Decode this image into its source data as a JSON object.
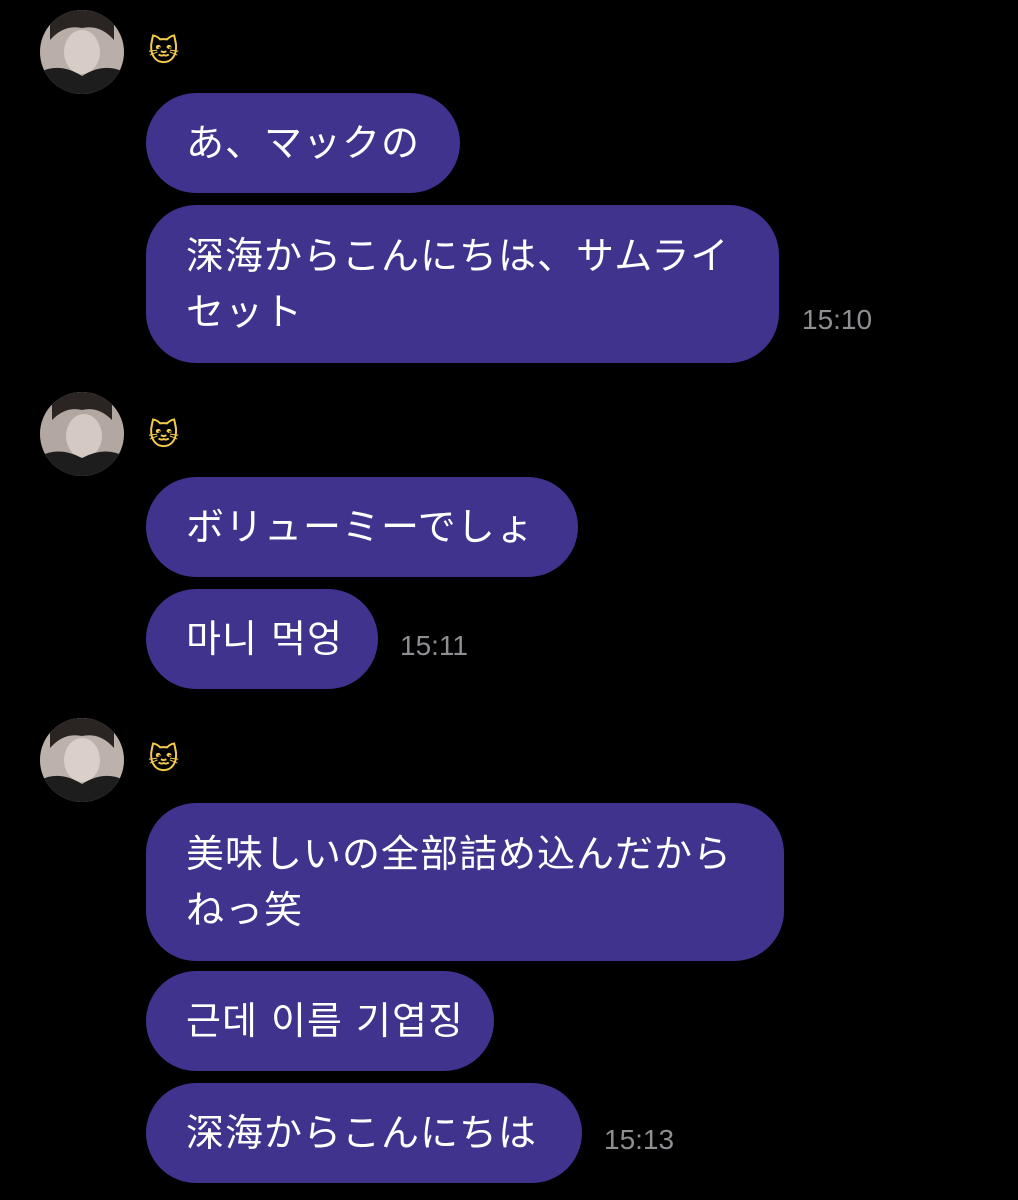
{
  "groups": [
    {
      "sender": {
        "name": "🐱",
        "avatar_icon": "profile-photo"
      },
      "messages": [
        {
          "text": "あ、マックの"
        },
        {
          "lines": [
            "深海からこんにちは、サムライ",
            "セット"
          ]
        }
      ],
      "time": "15:10"
    },
    {
      "sender": {
        "name": "🐱",
        "avatar_icon": "profile-photo"
      },
      "messages": [
        {
          "text": "ボリューミーでしょ"
        },
        {
          "text": "마니 먹엉"
        }
      ],
      "time": "15:11"
    },
    {
      "sender": {
        "name": "🐱",
        "avatar_icon": "profile-photo"
      },
      "messages": [
        {
          "lines": [
            "美味しいの全部詰め込んだから",
            "ねっ笑"
          ]
        },
        {
          "text": "근데 이름 기엽징"
        },
        {
          "text": "深海からこんにちは"
        }
      ],
      "time": "15:13"
    }
  ],
  "colors": {
    "background": "#000000",
    "bubble": "#3f338e",
    "bubble_text": "#ffffff",
    "timestamp": "#8e8e93"
  }
}
